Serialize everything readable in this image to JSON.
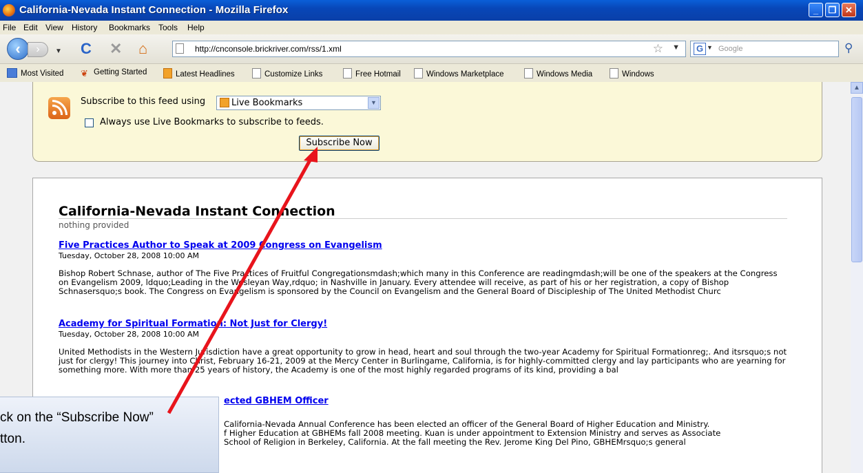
{
  "window": {
    "title": "California-Nevada Instant Connection - Mozilla Firefox",
    "minimize": "_",
    "maximize": "❐",
    "close": "✕"
  },
  "menu": [
    "File",
    "Edit",
    "View",
    "History",
    "Bookmarks",
    "Tools",
    "Help"
  ],
  "nav": {
    "url": "http://cnconsole.brickriver.com/rss/1.xml",
    "search_placeholder": "Google",
    "search_engine_letter": "G"
  },
  "bookmarks": [
    "Most Visited",
    "Getting Started",
    "Latest Headlines",
    "Customize Links",
    "Free Hotmail",
    "Windows Marketplace",
    "Windows Media",
    "Windows"
  ],
  "subscribe": {
    "label": "Subscribe to this feed using",
    "selected_reader": "Live Bookmarks",
    "checkbox_label": "Always use Live Bookmarks to subscribe to feeds.",
    "checkbox_checked": false,
    "button": "Subscribe Now"
  },
  "feed": {
    "title": "California-Nevada Instant Connection",
    "subtitle": "nothing provided",
    "entries": [
      {
        "title": "Five Practices Author to Speak at 2009 Congress on Evangelism",
        "date": "Tuesday, October 28, 2008 10:00 AM",
        "body": "Bishop Robert Schnase, author of The Five Practices of Fruitful Congregationsmdash;which many in this Conference are readingmdash;will be one of the speakers at the Congress on Evangelism 2009, ldquo;Leading in the Wesleyan Way,rdquo; in Nashville in January. Every attendee will receive, as part of his or her registration, a copy of Bishop Schnasersquo;s book. The Congress on Evangelism is sponsored by the Council on Evangelism and the General Board of Discipleship of The United Methodist Churc"
      },
      {
        "title": "Academy for Spiritual Formation: Not Just for Clergy!",
        "date": "Tuesday, October 28, 2008 10:00 AM",
        "body": "United Methodists in the Western Jurisdiction have a great opportunity to grow in head, heart and soul through the two-year Academy for Spiritual Formationreg;. And itsrsquo;s not just for clergy! This journey into Christ, February 16-21, 2009 at the Mercy Center in Burlingame, California, is for highly-committed clergy and lay participants who are yearning for something more. With more than 25 years of history, the Academy is one of the most highly regarded programs of its kind, providing a bal"
      },
      {
        "title": "ected GBHEM Officer",
        "body_lines": [
          "California-Nevada Annual Conference has been elected an officer of the General Board of Higher Education and Ministry.",
          "f Higher Education at GBHEMs fall 2008 meeting. Kuan is under appointment to Extension Ministry and serves as Associate",
          "School of Religion in Berkeley, California. At the fall meeting the Rev. Jerome King Del Pino, GBHEMrsquo;s general"
        ]
      }
    ]
  },
  "callout": {
    "line1": "ck on the “Subscribe Now”",
    "line2": "tton."
  },
  "colors": {
    "annotation_arrow": "#e8141c",
    "link": "#0000ee",
    "subscribe_panel": "#fbf8d8"
  }
}
